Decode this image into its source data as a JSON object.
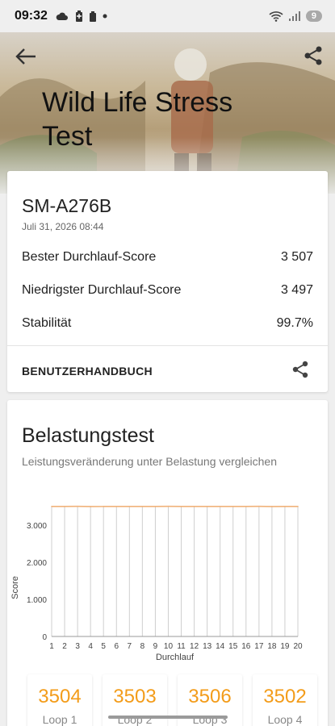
{
  "status_bar": {
    "time": "09:32",
    "notification_count": "9",
    "icons": [
      "cloud-icon",
      "battery-saver-icon",
      "battery-icon",
      "dot-icon",
      "wifi-icon",
      "signal-icon"
    ]
  },
  "header": {
    "title": "Wild Life Stress Test",
    "back_icon": "arrow-left-icon",
    "share_icon": "share-icon"
  },
  "summary": {
    "device": "SM-A276B",
    "date": "Juli 31, 2026 08:44",
    "rows": [
      {
        "label": "Bester Durchlauf-Score",
        "value": "3 507"
      },
      {
        "label": "Niedrigster Durchlauf-Score",
        "value": "3 497"
      },
      {
        "label": "Stabilität",
        "value": "99.7%"
      }
    ],
    "manual_label": "BENUTZERHANDBUCH"
  },
  "stress": {
    "title": "Belastungstest",
    "subtitle": "Leistungsveränderung unter Belastung vergleichen"
  },
  "chart_data": {
    "type": "line",
    "xlabel": "Durchlauf",
    "ylabel": "Score",
    "x": [
      1,
      2,
      3,
      4,
      5,
      6,
      7,
      8,
      9,
      10,
      11,
      12,
      13,
      14,
      15,
      16,
      17,
      18,
      19,
      20
    ],
    "y_ticks": [
      "0",
      "1.000",
      "2.000",
      "3.000"
    ],
    "ylim": [
      0,
      3500
    ],
    "grid": "vertical",
    "series": [
      {
        "values": [
          3504,
          3503,
          3506,
          3502,
          3503,
          3505,
          3504,
          3503,
          3505,
          3506,
          3504,
          3503,
          3504,
          3505,
          3503,
          3504,
          3506,
          3502,
          3504,
          3503
        ],
        "color": "#f0b27a"
      }
    ]
  },
  "loops": [
    {
      "score": "3504",
      "label": "Loop 1"
    },
    {
      "score": "3503",
      "label": "Loop 2"
    },
    {
      "score": "3506",
      "label": "Loop 3"
    },
    {
      "score": "3502",
      "label": "Loop 4"
    }
  ],
  "colors": {
    "accent": "#f39c1a",
    "line": "#f0b27a"
  }
}
